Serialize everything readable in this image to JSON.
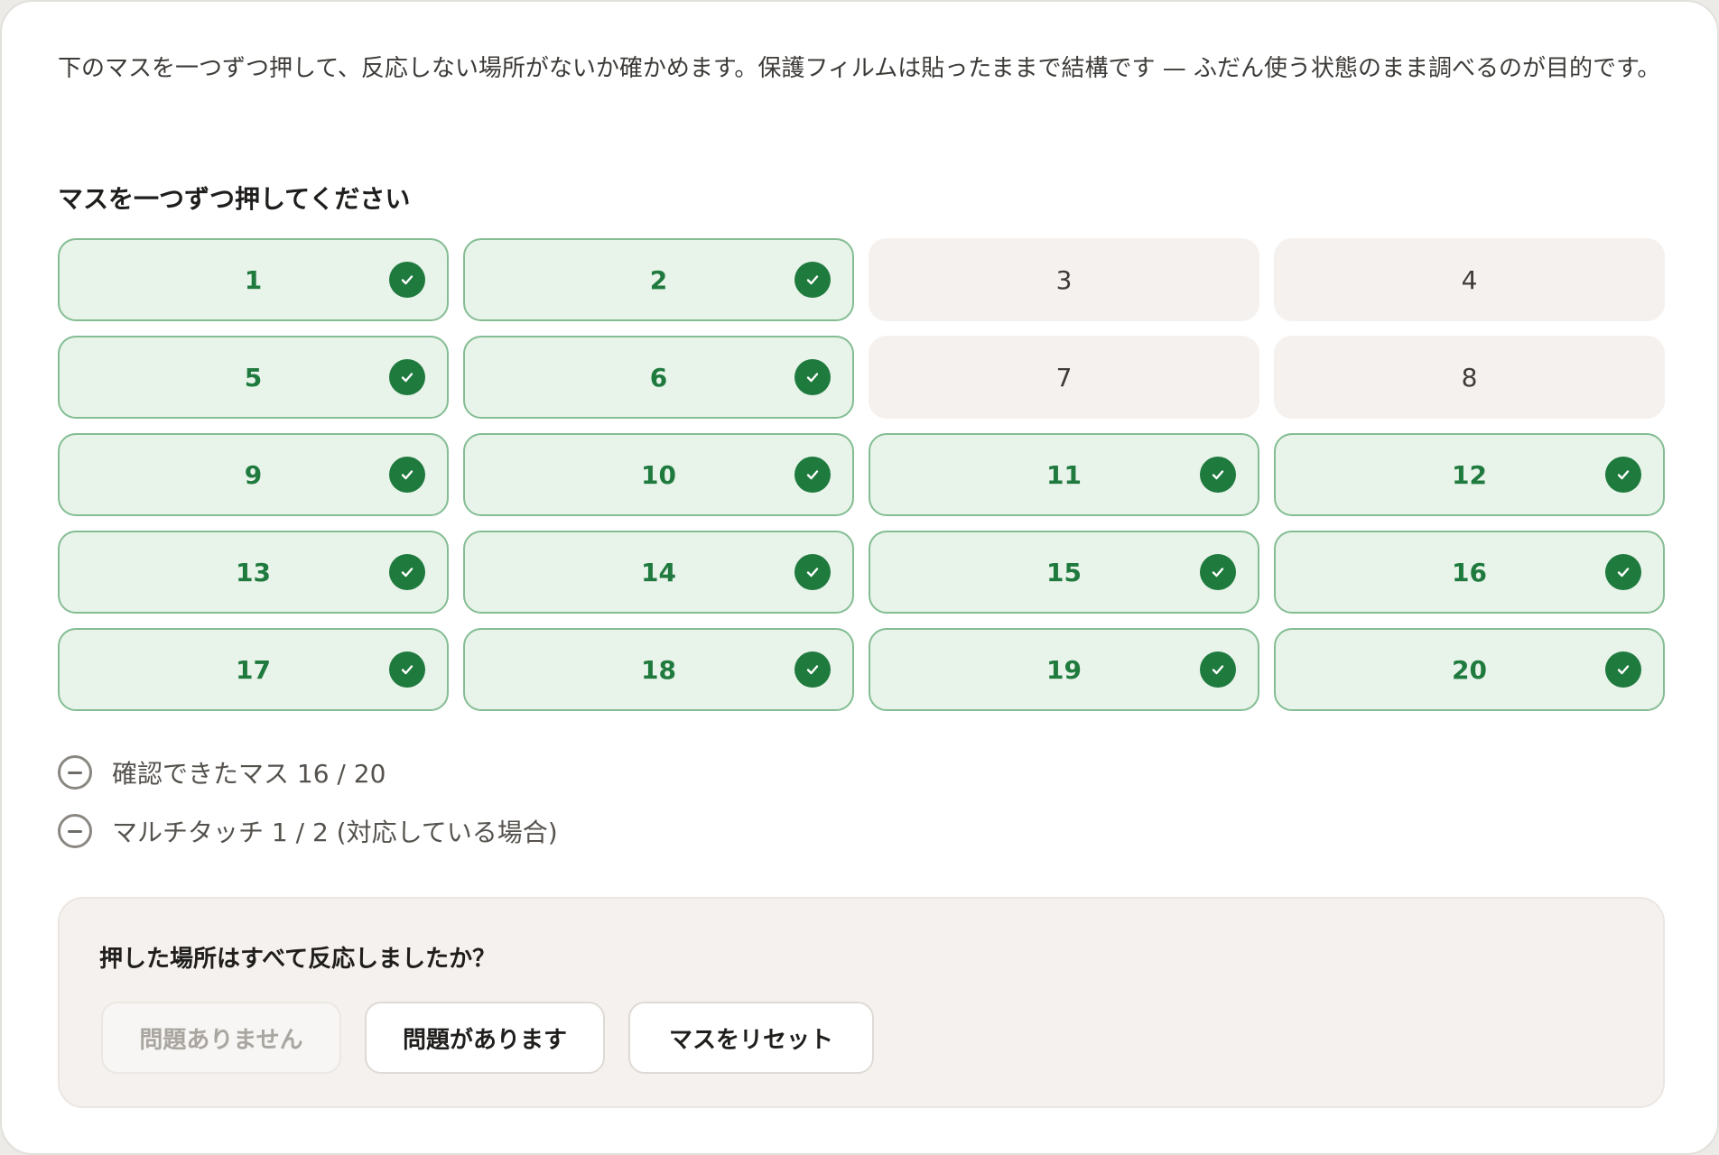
{
  "intro_text": "下のマスを一つずつ押して、反応しない場所がないか確かめます。保護フィルムは貼ったままで結構です — ふだん使う状態のまま調べるのが目的です。",
  "grid_title": "マスを一つずつ押してください",
  "tiles": [
    {
      "label": "1",
      "checked": true
    },
    {
      "label": "2",
      "checked": true
    },
    {
      "label": "3",
      "checked": false
    },
    {
      "label": "4",
      "checked": false
    },
    {
      "label": "5",
      "checked": true
    },
    {
      "label": "6",
      "checked": true
    },
    {
      "label": "7",
      "checked": false
    },
    {
      "label": "8",
      "checked": false
    },
    {
      "label": "9",
      "checked": true
    },
    {
      "label": "10",
      "checked": true
    },
    {
      "label": "11",
      "checked": true
    },
    {
      "label": "12",
      "checked": true
    },
    {
      "label": "13",
      "checked": true
    },
    {
      "label": "14",
      "checked": true
    },
    {
      "label": "15",
      "checked": true
    },
    {
      "label": "16",
      "checked": true
    },
    {
      "label": "17",
      "checked": true
    },
    {
      "label": "18",
      "checked": true
    },
    {
      "label": "19",
      "checked": true
    },
    {
      "label": "20",
      "checked": true
    }
  ],
  "status": {
    "tiles_confirmed": "確認できたマス 16 / 20",
    "multitouch": "マルチタッチ 1 / 2 (対応している場合)",
    "icon": "minus-circle-icon"
  },
  "question": {
    "title": "押した場所はすべて反応しましたか？",
    "no_problem_label": "問題ありません",
    "problem_label": "問題があります",
    "reset_label": "マスをリセット"
  },
  "colors": {
    "accent_green": "#1f7a3e",
    "tile_ok_bg": "#e8f3ea",
    "tile_pending_bg": "#f5f1ee"
  }
}
